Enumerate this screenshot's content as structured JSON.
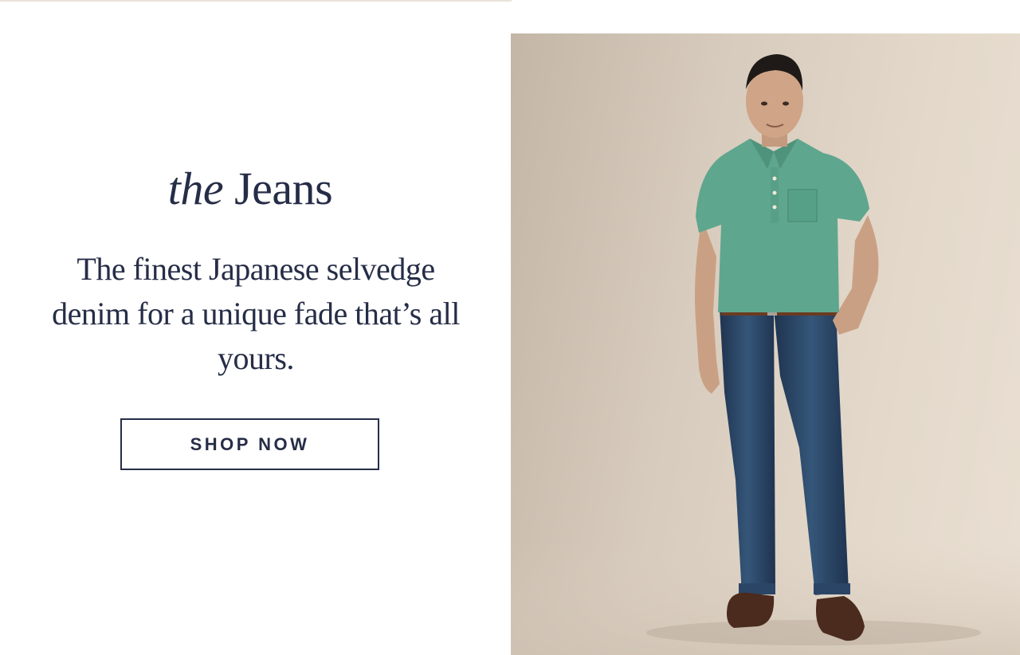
{
  "promo": {
    "title_italic": "the",
    "title_main": "Jeans",
    "description": "The finest Japanese selvedge denim for a unique fade that’s all yours.",
    "cta_label": "SHOP NOW"
  },
  "colors": {
    "navy": "#262d47",
    "background": "#ffffff",
    "photo_backdrop": "#ddd1c3",
    "shirt_green": "#5fa68e",
    "denim": "#27415f"
  },
  "image": {
    "subject": "model-wearing-green-polo-and-selvedge-jeans"
  }
}
